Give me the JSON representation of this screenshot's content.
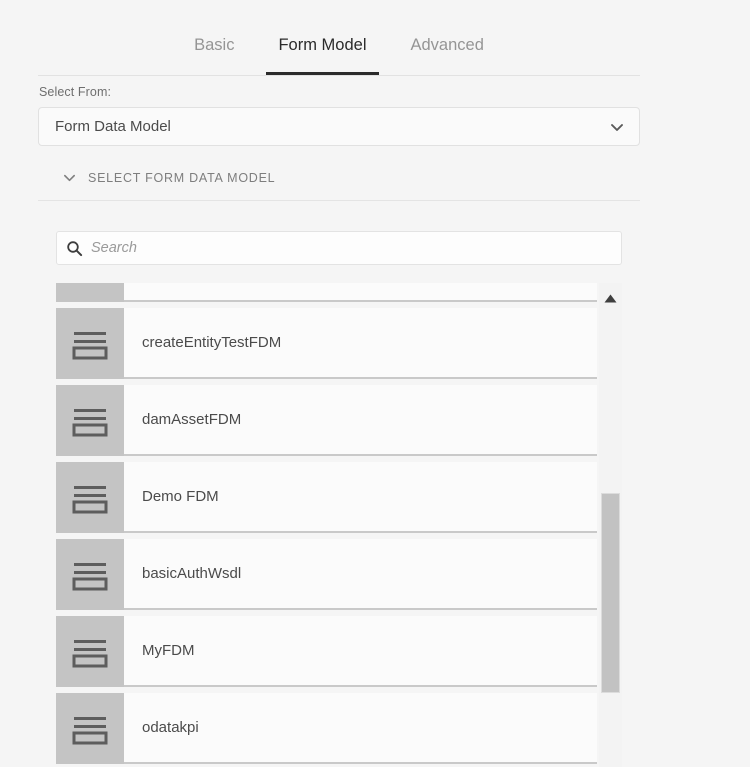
{
  "tabs": [
    {
      "label": "Basic",
      "active": false
    },
    {
      "label": "Form Model",
      "active": true
    },
    {
      "label": "Advanced",
      "active": false
    }
  ],
  "select_from": {
    "label": "Select From:",
    "value": "Form Data Model",
    "caret_icon": "chevron-down-icon"
  },
  "accordion": {
    "title": "SELECT FORM DATA MODEL",
    "caret_icon": "chevron-down-icon",
    "expanded": true
  },
  "search": {
    "placeholder": "Search",
    "value": "",
    "icon": "search-icon"
  },
  "list": {
    "item_icon": "form-data-model-icon",
    "items": [
      {
        "title": ""
      },
      {
        "title": "createEntityTestFDM"
      },
      {
        "title": "damAssetFDM"
      },
      {
        "title": "Demo FDM"
      },
      {
        "title": "basicAuthWsdl"
      },
      {
        "title": "MyFDM"
      },
      {
        "title": "odatakpi"
      }
    ]
  },
  "scrollbar": {
    "up_arrow_icon": "triangle-up-icon",
    "thumb_label": "scroll-thumb"
  },
  "colors": {
    "background": "#f5f5f5",
    "text": "#4b4b4b",
    "muted_text": "#959595",
    "active_tab": "#2b2b2b",
    "icon_tile": "#c4c4c4",
    "row_background": "#fbfbfb",
    "scroll_thumb": "#c2c2c2"
  }
}
